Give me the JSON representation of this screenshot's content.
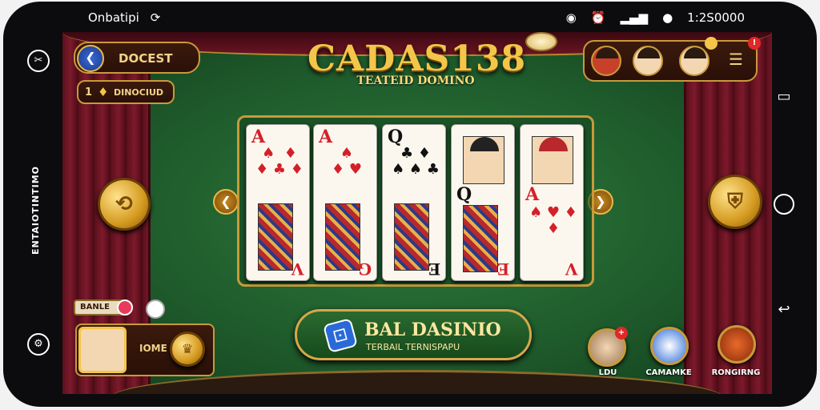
{
  "status_bar": {
    "carrier": "Onbatipi",
    "carrier_icon": "sync-icon",
    "time": "1:2S0000",
    "icons": [
      "wifi-icon",
      "alarm-icon",
      "signal-icon",
      "battery-icon"
    ]
  },
  "side_vertical_text": "ENTAIOTINTIMO",
  "game": {
    "title": "CADAS138",
    "subtitle": "TEATEID DOMINO",
    "balance": "DOCEST",
    "gems": "DINOCIUD",
    "gems_prefix": "1",
    "play_title": "BAL DASINIO",
    "play_subtitle": "TERBAIL TERNISPAPU",
    "small_label": "BANLE",
    "profile_label": "IOME",
    "cards": [
      {
        "rank": "A",
        "rank_b": "V",
        "color": "red",
        "pips": "♠  ♦\n♦ ♣ ♦",
        "face": true,
        "portrait": false
      },
      {
        "rank": "A",
        "rank_b": "G",
        "color": "red",
        "pips": "♠\n♦ ♥",
        "face": true,
        "portrait": false
      },
      {
        "rank": "Q",
        "rank_b": "E",
        "color": "black",
        "pips": "♣ ♦\n♠ ♠ ♣",
        "face": true,
        "portrait": false
      },
      {
        "rank": "Q",
        "rank_b": "E",
        "color": "black",
        "pips": "♠",
        "face": true,
        "portrait": true,
        "portrait_red": false
      },
      {
        "rank": "A",
        "rank_b": "V",
        "color": "red",
        "pips": "♠\n\n♥\n♦  ♦",
        "face": false,
        "portrait": true,
        "portrait_red": true
      }
    ],
    "bottom_icons": [
      {
        "label": "LDU",
        "icon": "avatar-icon",
        "badge": "+"
      },
      {
        "label": "CAMAMKE",
        "icon": "dice-icon"
      },
      {
        "label": "RONGIRNG",
        "icon": "trophy-icon"
      }
    ],
    "colors": {
      "felt": "#2e7a3c",
      "gold": "#c89a3a",
      "curtain": "#7d1a2b"
    }
  }
}
